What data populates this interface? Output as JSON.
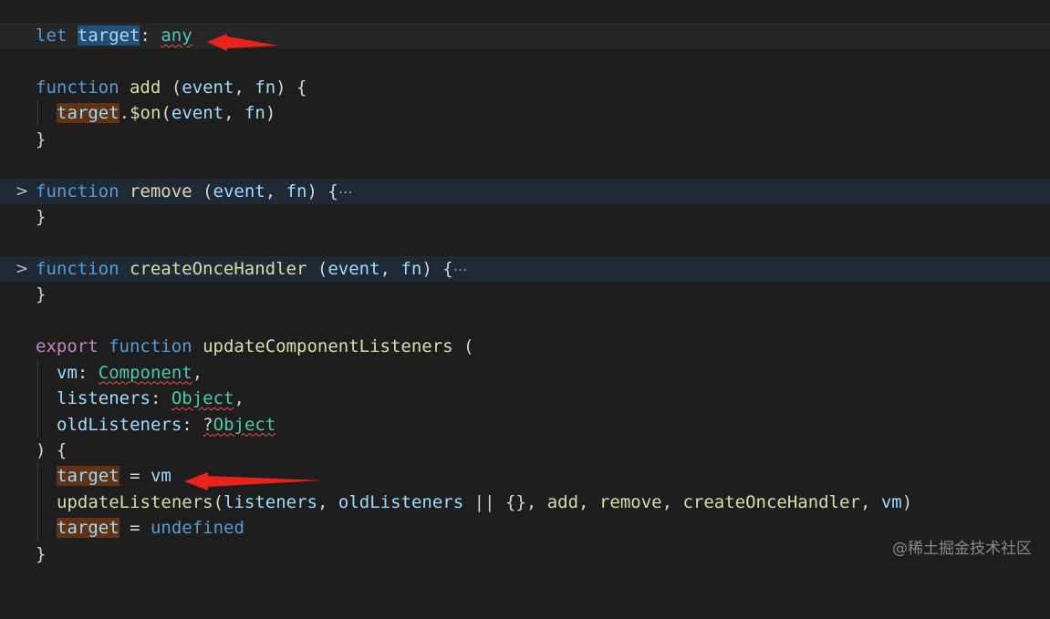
{
  "lines": {
    "l1": {
      "let": "let",
      "target": "target",
      "colon": ": ",
      "any": "any"
    },
    "l3": {
      "function": "function",
      "name": "add",
      "params": " (",
      "event": "event",
      "comma": ", ",
      "fn": "fn",
      "close": ") {"
    },
    "l4": {
      "target": "target",
      "rest": ".",
      "on": "$on",
      "open": "(",
      "event": "event",
      "comma": ", ",
      "fn": "fn",
      "close": ")"
    },
    "l5": {
      "brace": "}"
    },
    "l7": {
      "function": "function",
      "name": "remove",
      "open": " (",
      "event": "event",
      "comma": ", ",
      "fn": "fn",
      "close": ") {",
      "ellipsis": "⋯"
    },
    "l8": {
      "brace": "}"
    },
    "l10": {
      "function": "function",
      "name": "createOnceHandler",
      "open": " (",
      "event": "event",
      "comma": ", ",
      "fn": "fn",
      "close": ") {",
      "ellipsis": "⋯"
    },
    "l11": {
      "brace": "}"
    },
    "l13": {
      "export": "export",
      "function": "function",
      "name": "updateComponentListeners",
      "open": " ("
    },
    "l14": {
      "name": "vm",
      "colon": ": ",
      "type": "Component",
      "comma": ","
    },
    "l15": {
      "name": "listeners",
      "colon": ": ",
      "type": "Object",
      "comma": ","
    },
    "l16": {
      "name": "oldListeners",
      "colon": ": ",
      "q": "?",
      "type": "Object"
    },
    "l17": {
      "text": ") {"
    },
    "l18": {
      "target": "target",
      "eq": " = ",
      "vm": "vm"
    },
    "l19": {
      "fn": "updateListeners",
      "open": "(",
      "a1": "listeners",
      "c1": ", ",
      "a2": "oldListeners",
      "op": " || ",
      "obj": "{}",
      "c2": ", ",
      "a3": "add",
      "c3": ", ",
      "a4": "remove",
      "c4": ", ",
      "a5": "createOnceHandler",
      "c5": ", ",
      "a6": "vm",
      "close": ")"
    },
    "l20": {
      "target": "target",
      "eq": " = ",
      "undef": "undefined"
    },
    "l21": {
      "brace": "}"
    }
  },
  "fold_icon": "chevron-right-icon",
  "watermark": "@稀土掘金技术社区",
  "colors": {
    "background": "#1e1e1e",
    "keyword": "#569cd6",
    "function": "#dcdcaa",
    "variable": "#9cdcfe",
    "type": "#4ec9b0",
    "arrow": "#e8221c"
  }
}
